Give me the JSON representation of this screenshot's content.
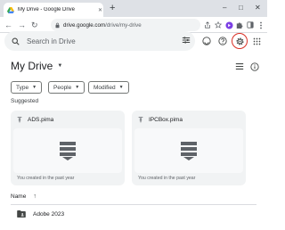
{
  "browser": {
    "tab_title": "My Drive - Google Drive",
    "tab_close": "✕",
    "new_tab": "+",
    "url_host": "drive.google.com",
    "url_path": "/drive/my-drive",
    "icons": [
      "back-icon",
      "forward-icon",
      "reload-icon",
      "lock-icon",
      "share-icon",
      "bookmark-star-icon",
      "extension-icon",
      "extensions-puzzle-icon",
      "sidebar-icon"
    ]
  },
  "drive": {
    "search_placeholder": "Search in Drive",
    "page_title": "My Drive",
    "filters": [
      {
        "label": "Type"
      },
      {
        "label": "People"
      },
      {
        "label": "Modified"
      }
    ],
    "suggested_label": "Suggested",
    "cards": [
      {
        "name": "ADS.pima",
        "subtitle": "You created in the past year"
      },
      {
        "name": "IPCBox.pima",
        "subtitle": "You created in the past year"
      }
    ],
    "name_column": "Name",
    "sort_arrow": "↑",
    "rows": [
      {
        "name": "Adobe 2023"
      }
    ],
    "accent_red": "#d93025",
    "header_icons": [
      "search-icon",
      "tune-icon",
      "support-icon",
      "help-icon",
      "settings-icon",
      "apps-grid-icon",
      "list-view-icon",
      "info-icon"
    ]
  }
}
